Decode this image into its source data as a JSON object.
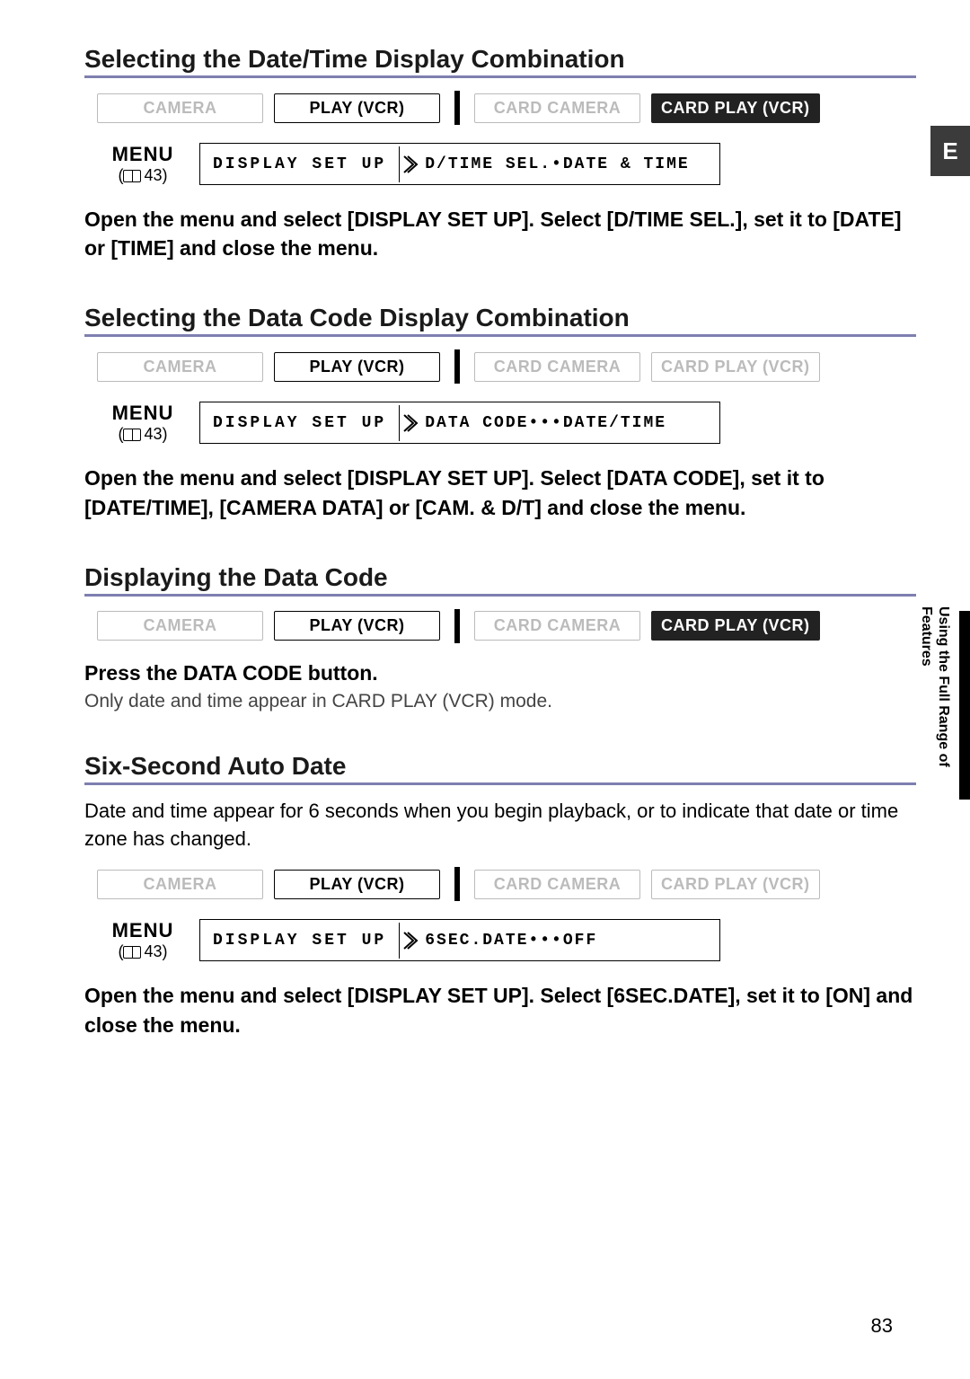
{
  "eTab": "E",
  "sideLabel": "Using the Full Range\nof Features",
  "pageNumber": "83",
  "menuWord": "MENU",
  "menuRef": "43",
  "modes": {
    "camera": "CAMERA",
    "playVcr": "PLAY (VCR)",
    "cardCamera": "CARD CAMERA",
    "cardPlayVcr": "CARD PLAY (VCR)"
  },
  "sec1": {
    "title": "Selecting the Date/Time Display Combination",
    "menuA": "DISPLAY SET UP",
    "menuB": "D/TIME SEL.•DATE & TIME",
    "body": "Open the menu and select [DISPLAY SET UP]. Select [D/TIME SEL.], set it to [DATE] or [TIME] and close the menu."
  },
  "sec2": {
    "title": "Selecting the Data Code Display Combination",
    "menuA": "DISPLAY SET UP",
    "menuB": "DATA CODE•••DATE/TIME",
    "body": "Open the menu and select [DISPLAY SET UP]. Select [DATA CODE], set it to [DATE/TIME], [CAMERA DATA] or [CAM. & D/T] and close the menu."
  },
  "sec3": {
    "title": "Displaying the Data Code",
    "instr": "Press the DATA CODE button.",
    "note": "Only date and time appear in CARD PLAY (VCR) mode."
  },
  "sec4": {
    "title": "Six-Second Auto Date",
    "lead": "Date and time appear for 6 seconds when you begin playback, or to indicate that date or time zone has changed.",
    "menuA": "DISPLAY SET UP",
    "menuB": "6SEC.DATE•••OFF",
    "body": "Open the menu and select [DISPLAY SET UP]. Select [6SEC.DATE], set it to [ON] and close the menu."
  }
}
